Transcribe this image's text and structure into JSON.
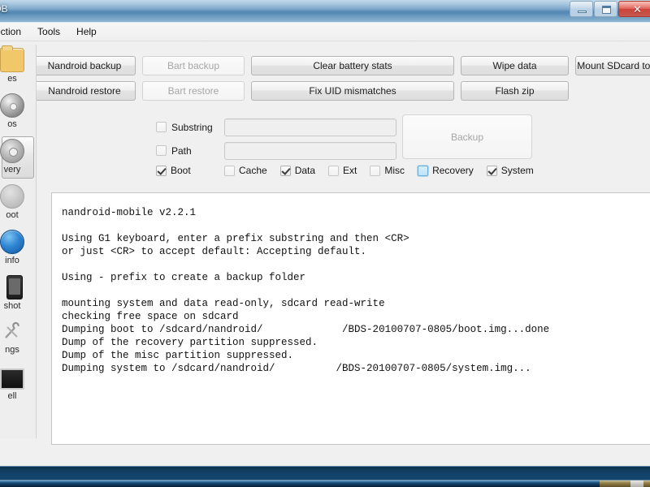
{
  "window": {
    "title": "QtADB",
    "title_visible": "DB",
    "controls": {
      "minimize": "Minimize",
      "maximize": "Maximize",
      "close": "Close"
    }
  },
  "menubar": {
    "items": [
      {
        "label": "ection",
        "full": "Connection"
      },
      {
        "label": "Tools",
        "full": "Tools"
      },
      {
        "label": "Help",
        "full": "Help"
      }
    ]
  },
  "sidebar": {
    "items": [
      {
        "label": "es",
        "full": "Files",
        "icon": "folder-icon",
        "selected": false
      },
      {
        "label": "os",
        "full": "Photos",
        "icon": "disc-icon",
        "selected": false
      },
      {
        "label": "very",
        "full": "Recovery",
        "icon": "gear-icon",
        "selected": true
      },
      {
        "label": "oot",
        "full": "Reboot",
        "icon": "power-icon",
        "selected": false
      },
      {
        "label": "info",
        "full": "Info",
        "icon": "info-icon",
        "selected": false
      },
      {
        "label": "shot",
        "full": "Screenshot",
        "icon": "phone-icon",
        "selected": false
      },
      {
        "label": "ngs",
        "full": "Settings",
        "icon": "tools-icon",
        "selected": false
      },
      {
        "label": "ell",
        "full": "Shell",
        "icon": "terminal-icon",
        "selected": false
      }
    ]
  },
  "toolbar": {
    "row1": [
      {
        "label": "Nandroid backup",
        "disabled": false,
        "width": "w-nand"
      },
      {
        "label": "Bart backup",
        "disabled": true,
        "width": "w-bart"
      },
      {
        "label": "Clear battery stats",
        "disabled": false,
        "width": "w-clear"
      },
      {
        "label": "Wipe data",
        "disabled": false,
        "width": "w-wipe"
      },
      {
        "label": "Mount SDcard to computer",
        "disabled": false,
        "width": "w-mount"
      }
    ],
    "row2": [
      {
        "label": "Nandroid restore",
        "disabled": false,
        "width": "w-nand"
      },
      {
        "label": "Bart restore",
        "disabled": true,
        "width": "w-bart"
      },
      {
        "label": "Fix UID mismatches",
        "disabled": false,
        "width": "w-clear"
      },
      {
        "label": "Flash zip",
        "disabled": false,
        "width": "w-wipe"
      }
    ]
  },
  "form": {
    "substring": {
      "label": "Substring",
      "checked": false,
      "value": "",
      "placeholder": ""
    },
    "path": {
      "label": "Path",
      "checked": false,
      "value": "",
      "placeholder": ""
    },
    "backup_button": {
      "label": "Backup",
      "disabled": true
    }
  },
  "partitions": [
    {
      "label": "Boot",
      "checked": true,
      "focused": false
    },
    {
      "label": "Cache",
      "checked": false,
      "focused": false
    },
    {
      "label": "Data",
      "checked": true,
      "focused": false
    },
    {
      "label": "Ext",
      "checked": false,
      "focused": false
    },
    {
      "label": "Misc",
      "checked": false,
      "focused": false
    },
    {
      "label": "Recovery",
      "checked": false,
      "focused": true
    },
    {
      "label": "System",
      "checked": true,
      "focused": false
    }
  ],
  "console": {
    "text": "nandroid-mobile v2.2.1\n\nUsing G1 keyboard, enter a prefix substring and then <CR>\nor just <CR> to accept default: Accepting default.\n\nUsing - prefix to create a backup folder\n\nmounting system and data read-only, sdcard read-write\nchecking free space on sdcard\nDumping boot to /sdcard/nandroid/             /BDS-20100707-0805/boot.img...done\nDump of the recovery partition suppressed.\nDump of the misc partition suppressed.\nDumping system to /sdcard/nandroid/          /BDS-20100707-0805/system.img..."
  },
  "colors": {
    "window_chrome": "#6d9dc4",
    "close_button": "#d7463a",
    "focus_blue": "#bfe3f7",
    "console_bg": "#ffffff",
    "panel_bg": "#f0f0f0"
  }
}
